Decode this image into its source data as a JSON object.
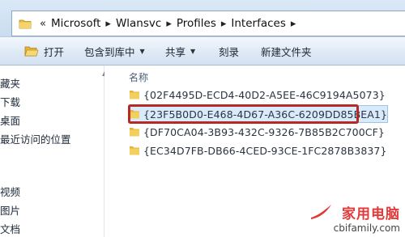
{
  "address_bar": {
    "lead_chevron": "«",
    "separator": "▸",
    "crumbs": [
      "Microsoft",
      "Wlansvc",
      "Profiles",
      "Interfaces"
    ]
  },
  "toolbar": {
    "open_label": "打开",
    "include_label": "包含到库中",
    "share_label": "共享",
    "burn_label": "刻录",
    "new_folder_label": "新建文件夹",
    "dropdown_arrow": "▼"
  },
  "sidebar": {
    "items": [
      "藏夹",
      "下载",
      "桌面",
      "最近访问的位置",
      "视频",
      "图片",
      "文档"
    ]
  },
  "list": {
    "column_name": "名称",
    "folders": [
      "{02F4495D-ECD4-40D2-A5EE-46C9194A5073}",
      "{23F5B0D0-E468-4D67-A36C-6209DD85BEA1}",
      "{DF70CA04-3B93-432C-9326-7B85B2C700CF}",
      "{EC34D7FB-DB66-4CED-93CE-1FC2878B3837}"
    ],
    "selected_index": 1
  },
  "watermark": {
    "title": "家用电脑",
    "url": "cbifamily.com"
  },
  "colors": {
    "highlight_border": "#b52a26",
    "folder_yellow": "#f1c84b",
    "toolbar_bg": "#dde8f5"
  }
}
